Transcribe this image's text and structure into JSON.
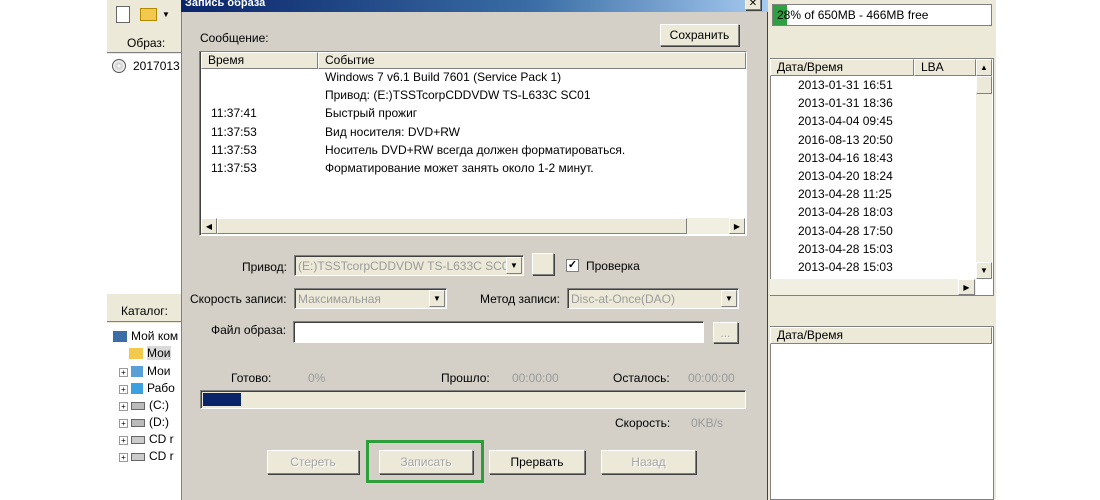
{
  "dialog": {
    "title": "Запись образа",
    "message_label": "Сообщение:",
    "save_button": "Сохранить",
    "log_columns": [
      "Время",
      "Событие"
    ],
    "log_rows": [
      {
        "time": "",
        "event": "Windows 7 v6.1 Build 7601 (Service Pack 1)"
      },
      {
        "time": "",
        "event": "Привод: (E:)TSSTcorpCDDVDW TS-L633C SC01"
      },
      {
        "time": "11:37:41",
        "event": "Быстрый прожиг"
      },
      {
        "time": "11:37:53",
        "event": "Вид носителя: DVD+RW"
      },
      {
        "time": "11:37:53",
        "event": "Носитель DVD+RW всегда должен форматироваться."
      },
      {
        "time": "11:37:53",
        "event": "Форматирование может занять около 1-2 минут."
      }
    ],
    "drive_label": "Привод:",
    "drive_value": "(E:)TSSTcorpCDDVDW TS-L633C SC01",
    "verify_label": "Проверка",
    "verify_checked": true,
    "speed_label": "Скорость записи:",
    "speed_value": "Максимальная",
    "method_label": "Метод записи:",
    "method_value": "Disc-at-Once(DAO)",
    "image_file_label": "Файл образа:",
    "image_file_value": "",
    "browse_button": "...",
    "ready_label": "Готово:",
    "ready_value": "0%",
    "elapsed_label": "Прошло:",
    "elapsed_value": "00:00:00",
    "remaining_label": "Осталось:",
    "remaining_value": "00:00:00",
    "speed_stat_label": "Скорость:",
    "speed_stat_value": "0KB/s",
    "progress_fraction": 0.07,
    "buttons": {
      "erase": "Стереть",
      "write": "Записать",
      "abort": "Прервать",
      "back": "Назад"
    }
  },
  "background": {
    "capacity_text": "28% of 650MB - 466MB free",
    "image_label": "Образ:",
    "image_item": "2017013",
    "catalog_label": "Каталог:",
    "tree_items": [
      "Мой ком",
      "Мои",
      "Мои",
      "Рабо",
      "(C:)",
      "(D:)",
      "CD r",
      "CD r"
    ],
    "top_columns": [
      "Дата/Время",
      "LBA"
    ],
    "dates": [
      "2013-01-31 16:51",
      "2013-01-31 18:36",
      "2013-04-04 09:45",
      "2016-08-13 20:50",
      "2013-04-16 18:43",
      "2013-04-20 18:24",
      "2013-04-28 11:25",
      "2013-04-28 18:03",
      "2013-04-28 17:50",
      "2013-04-28 15:03",
      "2013-04-28 15:03"
    ],
    "bottom_column": "Дата/Время"
  },
  "colors": {
    "dialog_bg": "#d4d0c8",
    "highlight": "#2e9e3a",
    "progress": "#0a246a"
  }
}
